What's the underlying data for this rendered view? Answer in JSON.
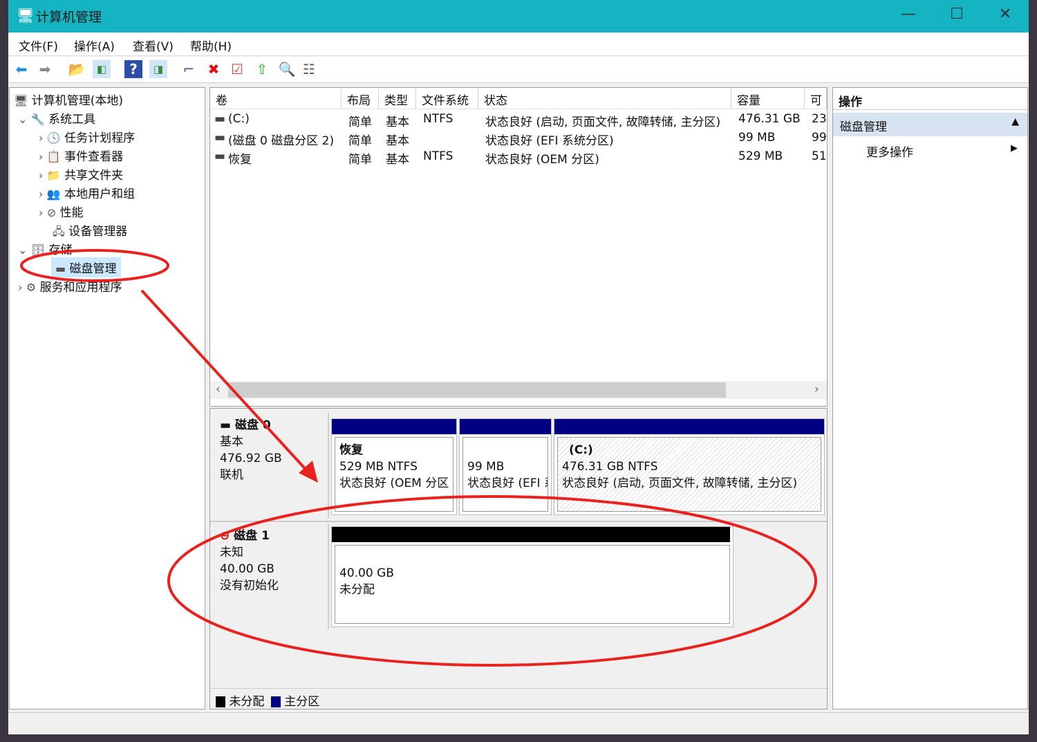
{
  "window": {
    "title": "计算机管理",
    "minimize": "—",
    "maximize": "☐",
    "close": "✕"
  },
  "menu": [
    "文件(F)",
    "操作(A)",
    "查看(V)",
    "帮助(H)"
  ],
  "toolbar": [
    "back-icon",
    "forward-icon",
    "up-folder-icon",
    "show-hide-tree-icon",
    "help-icon",
    "show-hide-action-icon",
    "connect-drive-icon",
    "delete-icon",
    "properties-icon",
    "open-icon",
    "search-icon",
    "view-list-icon"
  ],
  "tree": {
    "root": "计算机管理(本地)",
    "system_tools": "系统工具",
    "task_scheduler": "任务计划程序",
    "event_viewer": "事件查看器",
    "shared_folders": "共享文件夹",
    "local_users": "本地用户和组",
    "performance": "性能",
    "device_manager": "设备管理器",
    "storage": "存储",
    "disk_management": "磁盘管理",
    "services": "服务和应用程序"
  },
  "volumes": {
    "columns": [
      "卷",
      "布局",
      "类型",
      "文件系统",
      "状态",
      "容量",
      "可"
    ],
    "rows": [
      [
        "(C:)",
        "简单",
        "基本",
        "NTFS",
        "状态良好 (启动, 页面文件, 故障转储, 主分区)",
        "476.31 GB",
        "23"
      ],
      [
        "(磁盘 0 磁盘分区 2)",
        "简单",
        "基本",
        "",
        "状态良好 (EFI 系统分区)",
        "99 MB",
        "99"
      ],
      [
        "恢复",
        "简单",
        "基本",
        "NTFS",
        "状态良好 (OEM 分区)",
        "529 MB",
        "51"
      ]
    ]
  },
  "disks": [
    {
      "name": "磁盘 0",
      "type": "基本",
      "size": "476.92 GB",
      "status": "联机",
      "partitions": [
        {
          "label": "恢复",
          "size": "529 MB NTFS",
          "status": "状态良好 (OEM 分区"
        },
        {
          "label": "",
          "size": "99 MB",
          "status": "状态良好 (EFI 系"
        },
        {
          "label": "(C:)",
          "size": "476.31 GB NTFS",
          "status": "状态良好 (启动, 页面文件, 故障转储, 主分区)"
        }
      ]
    },
    {
      "name": "磁盘 1",
      "type": "未知",
      "size": "40.00 GB",
      "status": "没有初始化",
      "partitions": [
        {
          "size": "40.00 GB",
          "status": "未分配"
        }
      ]
    }
  ],
  "legend": [
    {
      "label": "未分配",
      "color": "#000000"
    },
    {
      "label": "主分区",
      "color": "#000080"
    }
  ],
  "actions": {
    "header": "操作",
    "section": "磁盘管理",
    "more": "更多操作"
  },
  "colors": {
    "titlebar": "#14b4c2",
    "primary_partition": "#000080",
    "unallocated": "#000000",
    "annotation": "#e8231f"
  }
}
